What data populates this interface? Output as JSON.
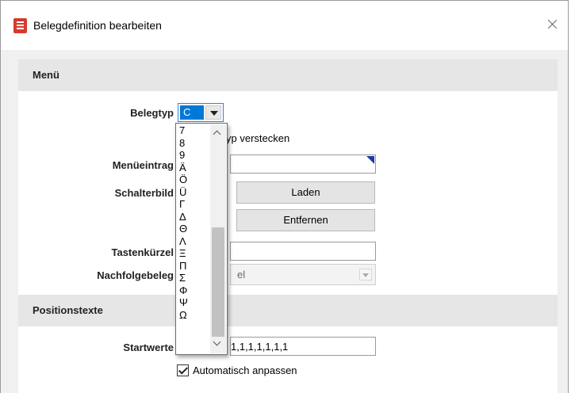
{
  "window": {
    "title": "Belegdefinition bearbeiten"
  },
  "sections": {
    "menu": "Menü",
    "positionstexte": "Positionstexte"
  },
  "form": {
    "belegtyp_label": "Belegtyp",
    "belegtyp_value": "C",
    "hide_checkbox_label_partial": "yp verstecken",
    "menueintrag_label": "Menüeintrag",
    "schalterbild_label": "Schalterbild",
    "laden_button": "Laden",
    "entfernen_button": "Entfernen",
    "tastenkuerzel_label": "Tastenkürzel",
    "nachfolgebeleg_label": "Nachfolgebeleg",
    "nachfolgebeleg_value_partial": "el",
    "startwerte_label": "Startwerte",
    "startwerte_value_partial": "1,1,1,1,1,1,1",
    "auto_adjust_label": "Automatisch anpassen",
    "auto_adjust_checked": true
  },
  "dropdown": {
    "items": [
      "7",
      "8",
      "9",
      "Ä",
      "Ö",
      "Ü",
      "Γ",
      "Δ",
      "Θ",
      "Λ",
      "Ξ",
      "Π",
      "Σ",
      "Φ",
      "Ψ",
      "Ω"
    ]
  },
  "colors": {
    "accent": "#0078d7",
    "section_bg": "#e6e6e6",
    "icon_red": "#d63b2d"
  }
}
